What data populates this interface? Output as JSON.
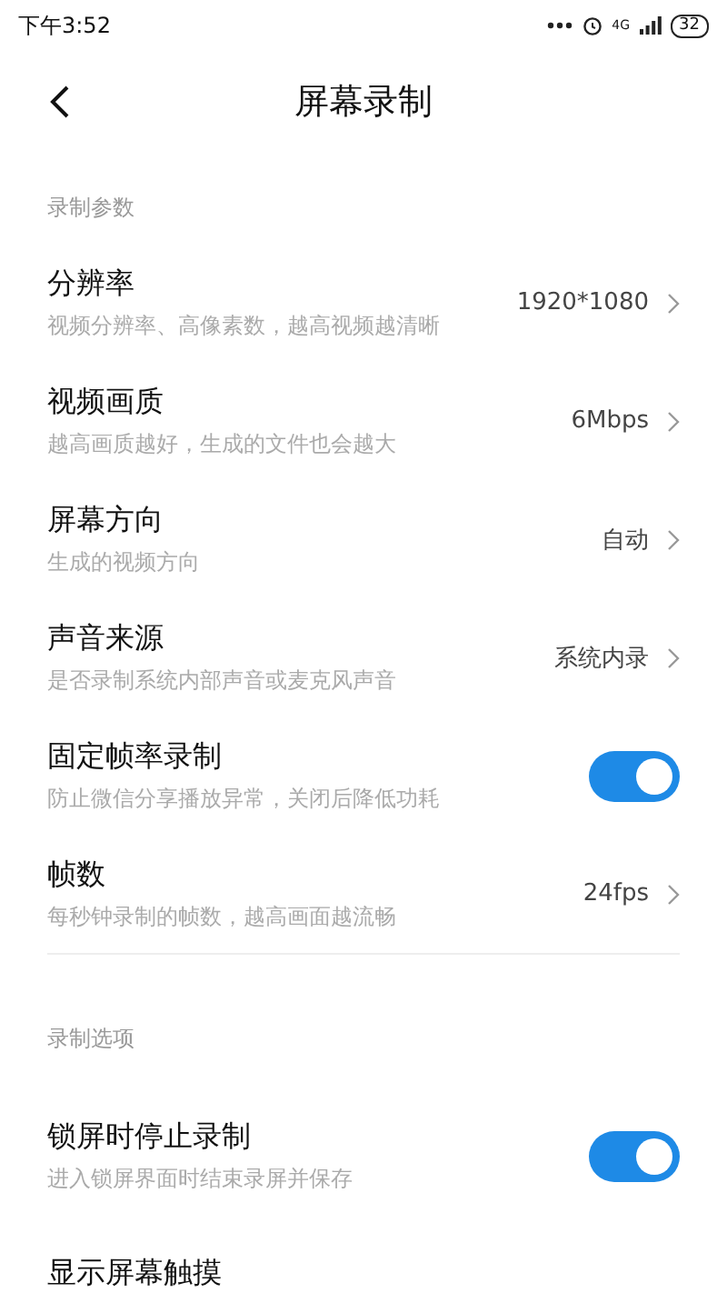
{
  "status_bar": {
    "time": "下午3:52",
    "battery": "32",
    "network": "4G"
  },
  "header": {
    "title": "屏幕录制"
  },
  "sections": [
    {
      "label": "录制参数",
      "items": [
        {
          "kind": "value",
          "title": "分辨率",
          "subtitle": "视频分辨率、高像素数，越高视频越清晰",
          "value": "1920*1080"
        },
        {
          "kind": "value",
          "title": "视频画质",
          "subtitle": "越高画质越好，生成的文件也会越大",
          "value": "6Mbps"
        },
        {
          "kind": "value",
          "title": "屏幕方向",
          "subtitle": "生成的视频方向",
          "value": "自动"
        },
        {
          "kind": "value",
          "title": "声音来源",
          "subtitle": "是否录制系统内部声音或麦克风声音",
          "value": "系统内录"
        },
        {
          "kind": "toggle",
          "title": "固定帧率录制",
          "subtitle": "防止微信分享播放异常，关闭后降低功耗",
          "on": true
        },
        {
          "kind": "value",
          "title": "帧数",
          "subtitle": "每秒钟录制的帧数，越高画面越流畅",
          "value": "24fps"
        }
      ]
    },
    {
      "label": "录制选项",
      "items": [
        {
          "kind": "toggle",
          "title": "锁屏时停止录制",
          "subtitle": "进入锁屏界面时结束录屏并保存",
          "on": true
        },
        {
          "kind": "value",
          "title": "显示屏幕触摸"
        }
      ]
    }
  ]
}
